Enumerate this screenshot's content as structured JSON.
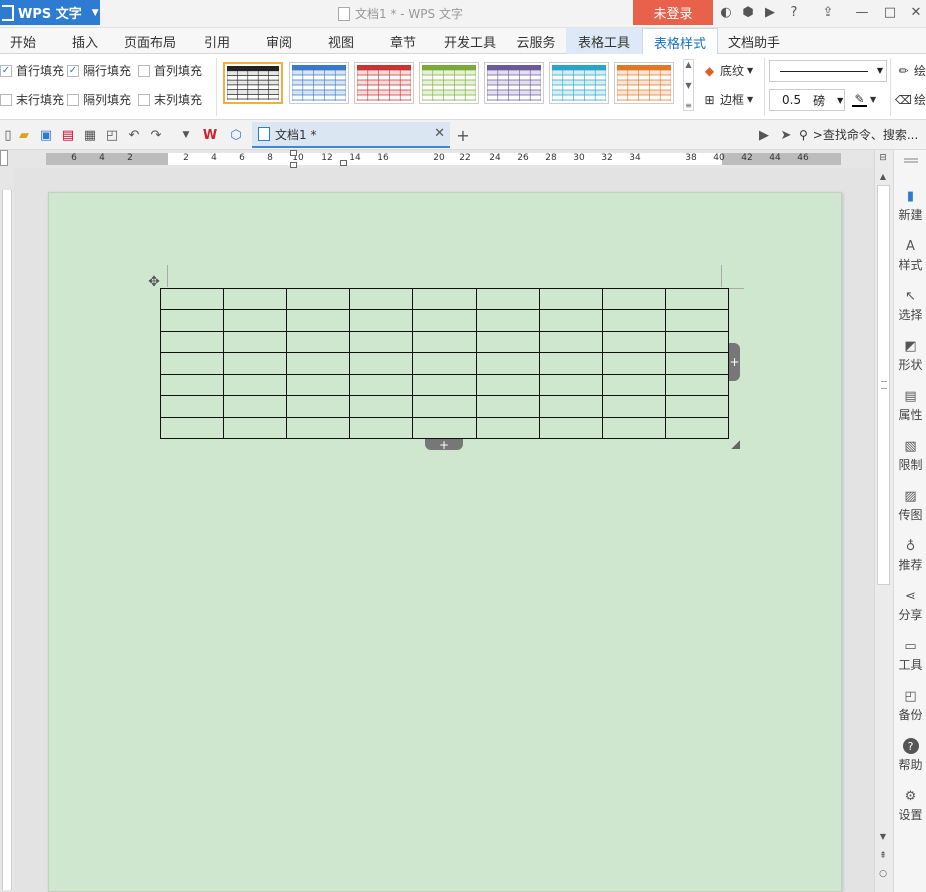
{
  "app": {
    "name": "WPS 文字",
    "window_title": "文档1 * - WPS 文字",
    "login": "未登录"
  },
  "menu": {
    "tabs": [
      "开始",
      "插入",
      "页面布局",
      "引用",
      "审阅",
      "视图",
      "章节",
      "开发工具",
      "云服务",
      "表格工具",
      "表格样式",
      "文档助手"
    ],
    "active": "表格样式"
  },
  "ribbon": {
    "checks": [
      {
        "label": "首行填充",
        "checked": true
      },
      {
        "label": "隔行填充",
        "checked": true
      },
      {
        "label": "首列填充",
        "checked": false
      },
      {
        "label": "末行填充",
        "checked": false
      },
      {
        "label": "隔列填充",
        "checked": false
      },
      {
        "label": "末列填充",
        "checked": false
      }
    ],
    "styles": [
      {
        "color": "#222222",
        "fill": "#e6e6e6"
      },
      {
        "color": "#3a78c8",
        "fill": "#d6e4f5"
      },
      {
        "color": "#cc3333",
        "fill": "#f5dada"
      },
      {
        "color": "#7aab3a",
        "fill": "#e6f1d6"
      },
      {
        "color": "#6a5a9a",
        "fill": "#e3dff0"
      },
      {
        "color": "#2aa5c5",
        "fill": "#d4eef6"
      },
      {
        "color": "#e0782a",
        "fill": "#fbe4d2"
      }
    ],
    "shading_label": "底纹",
    "border_label": "边框",
    "line_weight": "0.5",
    "line_unit": "磅",
    "draw_label": "绘",
    "erase_label": "绘"
  },
  "doc_tab": {
    "title": "文档1 *"
  },
  "search": {
    "placeholder": ">查找命令、搜索..."
  },
  "ruler": {
    "numbers": [
      "6",
      "4",
      "2",
      "2",
      "4",
      "6",
      "8",
      "10",
      "12",
      "14",
      "16",
      "20",
      "22",
      "24",
      "26",
      "28",
      "30",
      "32",
      "34",
      "38",
      "40",
      "42",
      "44",
      "46"
    ]
  },
  "right_panel": [
    "新建",
    "样式",
    "选择",
    "形状",
    "属性",
    "限制",
    "传图",
    "推荐",
    "分享",
    "工具",
    "备份",
    "帮助",
    "设置"
  ],
  "table": {
    "rows": 7,
    "cols": 9
  },
  "colors": {
    "accent": "#2d7cd1",
    "login": "#e8614a",
    "page": "#cfe6cf"
  }
}
